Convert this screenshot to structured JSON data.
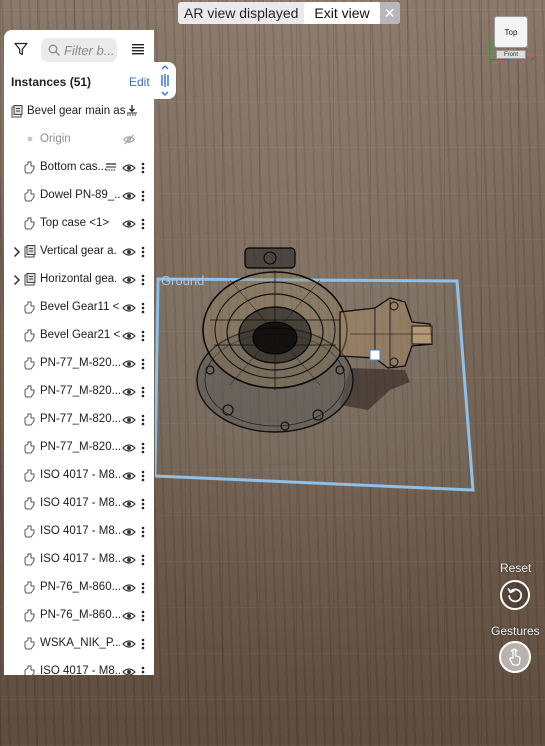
{
  "banner": {
    "status_text": "AR view displayed",
    "exit_label": "Exit view",
    "close_glyph": "✕"
  },
  "viewcube": {
    "top_label": "Top",
    "front_label": "Front"
  },
  "panel": {
    "search_placeholder": "Filter b...",
    "title": "Instances (51)",
    "edit_label": "Edit",
    "rows": [
      {
        "label": "Bevel gear main ass...",
        "icon": "assembly-icon",
        "expandable": false,
        "trailing": "download-icon"
      },
      {
        "label": "Origin",
        "icon": "origin-dot-icon",
        "expandable": false,
        "trailing": "eye-hidden-icon"
      },
      {
        "label": "Bottom cas...",
        "icon": "part-icon",
        "expandable": false,
        "trailing": "eye-icon"
      },
      {
        "label": "Dowel PN-89_...",
        "icon": "part-icon",
        "expandable": false,
        "trailing": "eye-icon"
      },
      {
        "label": "Top case <1>",
        "icon": "part-icon",
        "expandable": false,
        "trailing": "eye-icon"
      },
      {
        "label": "Vertical gear a...",
        "icon": "assembly-icon",
        "expandable": true,
        "trailing": "eye-icon"
      },
      {
        "label": "Horizontal gea...",
        "icon": "assembly-icon",
        "expandable": true,
        "trailing": "eye-icon"
      },
      {
        "label": "Bevel Gear11 <...",
        "icon": "part-icon",
        "expandable": false,
        "trailing": "eye-icon"
      },
      {
        "label": "Bevel Gear21 <...",
        "icon": "part-icon",
        "expandable": false,
        "trailing": "eye-icon"
      },
      {
        "label": "PN-77_M-820...",
        "icon": "part-icon",
        "expandable": false,
        "trailing": "eye-icon"
      },
      {
        "label": "PN-77_M-820...",
        "icon": "part-icon",
        "expandable": false,
        "trailing": "eye-icon"
      },
      {
        "label": "PN-77_M-820...",
        "icon": "part-icon",
        "expandable": false,
        "trailing": "eye-icon"
      },
      {
        "label": "PN-77_M-820...",
        "icon": "part-icon",
        "expandable": false,
        "trailing": "eye-icon"
      },
      {
        "label": "ISO 4017 - M8...",
        "icon": "part-icon",
        "expandable": false,
        "trailing": "eye-icon"
      },
      {
        "label": "ISO 4017 - M8...",
        "icon": "part-icon",
        "expandable": false,
        "trailing": "eye-icon"
      },
      {
        "label": "ISO 4017 - M8...",
        "icon": "part-icon",
        "expandable": false,
        "trailing": "eye-icon"
      },
      {
        "label": "ISO 4017 - M8...",
        "icon": "part-icon",
        "expandable": false,
        "trailing": "eye-icon"
      },
      {
        "label": "PN-76_M-860...",
        "icon": "part-icon",
        "expandable": false,
        "trailing": "eye-icon"
      },
      {
        "label": "PN-76_M-860...",
        "icon": "part-icon",
        "expandable": false,
        "trailing": "eye-icon"
      },
      {
        "label": "WSKA_NIK_P...",
        "icon": "part-icon",
        "expandable": false,
        "trailing": "eye-icon"
      },
      {
        "label": "ISO 4017 - M8...",
        "icon": "part-icon",
        "expandable": false,
        "trailing": "eye-icon"
      }
    ]
  },
  "viewport": {
    "ground_label": "Ground"
  },
  "controls": {
    "reset_label": "Reset",
    "gestures_label": "Gestures"
  },
  "colors": {
    "accent": "#2d6ecf",
    "ground_outline": "#8fc0e8",
    "panel_bg": "#ffffff"
  }
}
